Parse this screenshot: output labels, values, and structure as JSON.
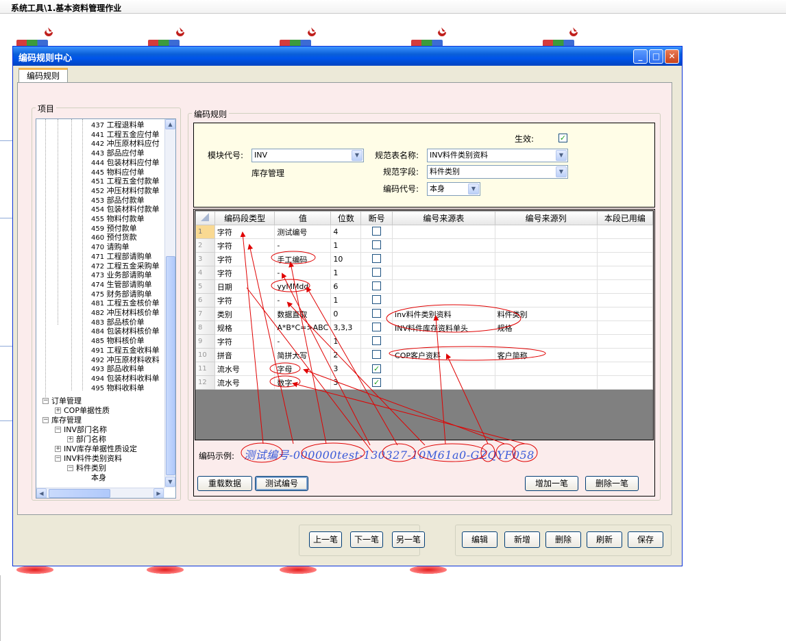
{
  "page": {
    "title": "系统工具\\1.基本资料管理作业"
  },
  "dialog": {
    "title": "编码规则中心",
    "tab": "编码规则",
    "tree_group": "项目",
    "rule_group": "编码规则"
  },
  "tree": {
    "items": [
      {
        "code": "437",
        "name": "工程退料单"
      },
      {
        "code": "441",
        "name": "工程五金应付单"
      },
      {
        "code": "442",
        "name": "冲压原材料应付"
      },
      {
        "code": "443",
        "name": "部品应付单"
      },
      {
        "code": "444",
        "name": "包装材料应付单"
      },
      {
        "code": "445",
        "name": "物料应付单"
      },
      {
        "code": "451",
        "name": "工程五金付款单"
      },
      {
        "code": "452",
        "name": "冲压材料付款单"
      },
      {
        "code": "453",
        "name": "部品付款单"
      },
      {
        "code": "454",
        "name": "包装材料付款单"
      },
      {
        "code": "455",
        "name": "物料付款单"
      },
      {
        "code": "459",
        "name": "预付款单"
      },
      {
        "code": "460",
        "name": "预付货款"
      },
      {
        "code": "470",
        "name": "请购单"
      },
      {
        "code": "471",
        "name": "工程部请购单"
      },
      {
        "code": "472",
        "name": "工程五金采购单"
      },
      {
        "code": "473",
        "name": "业务部请购单"
      },
      {
        "code": "474",
        "name": "生管部请购单"
      },
      {
        "code": "475",
        "name": "财务部请购单"
      },
      {
        "code": "481",
        "name": "工程五金核价单"
      },
      {
        "code": "482",
        "name": "冲压材料核价单"
      },
      {
        "code": "483",
        "name": "部品核价单"
      },
      {
        "code": "484",
        "name": "包装材料核价单"
      },
      {
        "code": "485",
        "name": "物料核价单"
      },
      {
        "code": "491",
        "name": "工程五金收料单"
      },
      {
        "code": "492",
        "name": "冲压原材料收料"
      },
      {
        "code": "493",
        "name": "部品收料单"
      },
      {
        "code": "494",
        "name": "包装材料收料单"
      },
      {
        "code": "495",
        "name": "物料收料单"
      }
    ],
    "order_mgmt": "订单管理",
    "cop_props": "COP单据性质",
    "inv_mgmt": "库存管理",
    "inv_dept": "INV部门名称",
    "dept_name": "部门名称",
    "inv_doc_props": "INV库存单据性质设定",
    "inv_category": "INV料件类别资料",
    "category": "料件类别",
    "self": "本身"
  },
  "form": {
    "effective_label": "生效:",
    "module_label": "模块代号:",
    "module_value": "INV",
    "module_desc": "库存管理",
    "table_label": "规范表名称:",
    "table_value": "INV料件类别资料",
    "field_label": "规范字段:",
    "field_value": "料件类别",
    "code_label": "编码代号:",
    "code_value": "本身"
  },
  "grid": {
    "headers": [
      "编码段类型",
      "值",
      "位数",
      "断号",
      "编号来源表",
      "编号来源列",
      "本段已用编"
    ],
    "rows": [
      {
        "n": "1",
        "type": "字符",
        "value": "测试编号",
        "digits": "4",
        "checked": false,
        "src": "",
        "col": ""
      },
      {
        "n": "2",
        "type": "字符",
        "value": "-",
        "digits": "1",
        "checked": false,
        "src": "",
        "col": ""
      },
      {
        "n": "3",
        "type": "字符",
        "value": "手工编码",
        "digits": "10",
        "checked": false,
        "src": "",
        "col": ""
      },
      {
        "n": "4",
        "type": "字符",
        "value": "-",
        "digits": "1",
        "checked": false,
        "src": "",
        "col": ""
      },
      {
        "n": "5",
        "type": "日期",
        "value": "yyMMdd",
        "digits": "6",
        "checked": false,
        "src": "",
        "col": ""
      },
      {
        "n": "6",
        "type": "字符",
        "value": "-",
        "digits": "1",
        "checked": false,
        "src": "",
        "col": ""
      },
      {
        "n": "7",
        "type": "类别",
        "value": "数据直取",
        "digits": "0",
        "checked": false,
        "src": "inv料件类别资料",
        "col": "料件类别"
      },
      {
        "n": "8",
        "type": "规格",
        "value": "A*B*C=>ABC",
        "digits": "3,3,3",
        "checked": false,
        "src": "INV料件库存资料单头",
        "col": "规格"
      },
      {
        "n": "9",
        "type": "字符",
        "value": "-",
        "digits": "1",
        "checked": false,
        "src": "",
        "col": ""
      },
      {
        "n": "10",
        "type": "拼音",
        "value": "简拼大写",
        "digits": "2",
        "checked": false,
        "src": "COP客户资料",
        "col": "客户简称"
      },
      {
        "n": "11",
        "type": "流水号",
        "value": "字母",
        "digits": "3",
        "checked": true,
        "src": "",
        "col": ""
      },
      {
        "n": "12",
        "type": "流水号",
        "value": "数字",
        "digits": "3",
        "checked": true,
        "src": "",
        "col": ""
      }
    ]
  },
  "example": {
    "label": "编码示例:",
    "value": "测试编号-000000test-130327-10M61a0-GZQYF058"
  },
  "buttons": {
    "reload": "重载数据",
    "test": "测试编号",
    "add_row": "增加一笔",
    "del_row": "删除一笔",
    "prev": "上一笔",
    "next": "下一笔",
    "another": "另一笔",
    "edit": "编辑",
    "new": "新增",
    "delete": "删除",
    "refresh": "刷新",
    "save": "保存"
  },
  "colors": {
    "title_bar": "#0055ea",
    "annotation": "#e00000",
    "example_text": "#3b5bd8",
    "form_bg": "#fffde7"
  }
}
